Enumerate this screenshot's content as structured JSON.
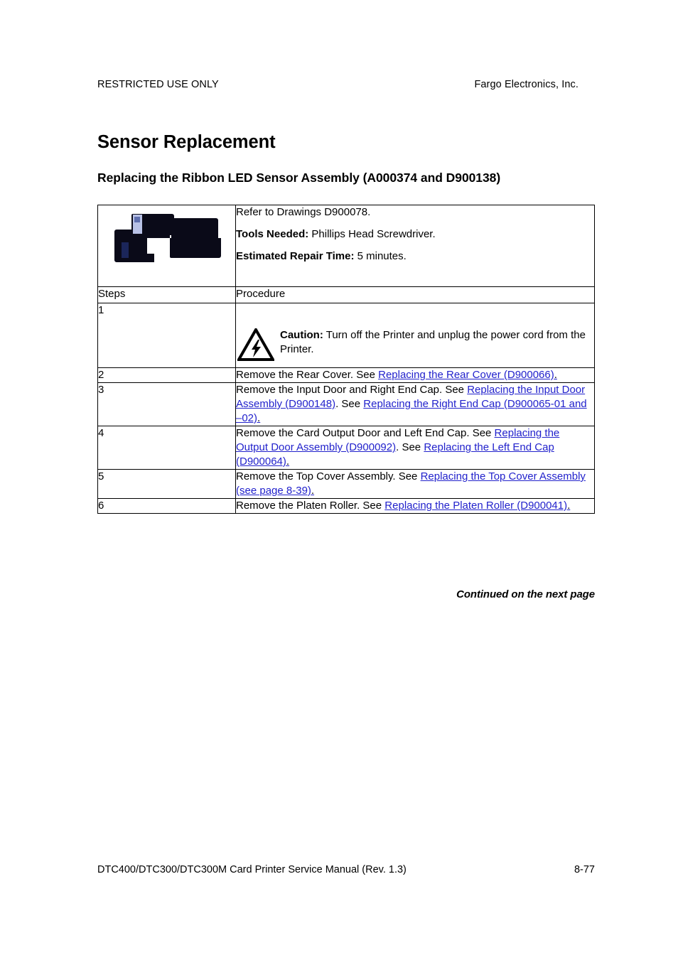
{
  "header": {
    "left": "RESTRICTED USE ONLY",
    "right": "Fargo Electronics, Inc."
  },
  "titles": {
    "h1": "Sensor Replacement",
    "h2": "Replacing the Ribbon LED Sensor Assembly (A000374 and D900138)"
  },
  "info_box": {
    "image_alt": "ribbon-led-sensor-assembly-photo",
    "line1": "Refer to Drawings D900078.",
    "tools_label": "Tools Needed:",
    "tools_value": " Phillips Head Screwdriver.",
    "time_label": "Estimated Repair Time:",
    "time_value": "  5 minutes."
  },
  "table": {
    "columns": [
      "Steps",
      "Procedure"
    ],
    "rows": [
      {
        "step": "1",
        "icon": "caution-electric-shock-icon",
        "caution_label": "Caution:",
        "text_after_label": "  Turn off the Printer and unplug the power cord from the Printer."
      },
      {
        "step": "2",
        "pre": "Remove the Rear Cover. See ",
        "link1": "Replacing the Rear Cover (D900066)",
        "mid": ".",
        "link2": "",
        "post": ""
      },
      {
        "step": "3",
        "pre": "Remove the Input Door and Right End Cap. See ",
        "link1": "Replacing the Input Door Assembly (D900148)",
        "mid": ". See ",
        "link2": "Replacing the Right End Cap (D900065-01 and –02)",
        "post": "."
      },
      {
        "step": "4",
        "pre": "Remove the Card Output Door and Left End Cap. See ",
        "link1": "Replacing the Output Door Assembly (D900092)",
        "mid": ". See ",
        "link2": "Replacing the Left End Cap (D900064)",
        "post": "."
      },
      {
        "step": "5",
        "pre": "Remove the Top Cover Assembly. See ",
        "link1": "Replacing the Top Cover Assembly (see page 8-39)",
        "mid": ".",
        "link2": "",
        "post": ""
      },
      {
        "step": "6",
        "pre": "Remove the Platen Roller. See ",
        "link1": "Replacing the Platen Roller (D900041)",
        "mid": ".",
        "link2": "",
        "post": ""
      }
    ]
  },
  "continued_note": "Continued on the next page",
  "footer": {
    "left": "DTC400/DTC300/DTC300M Card Printer Service Manual (Rev. 1.3)",
    "page": "8-77"
  },
  "colors": {
    "link": "#2222CC",
    "text": "#000000",
    "rule": "#000000"
  }
}
